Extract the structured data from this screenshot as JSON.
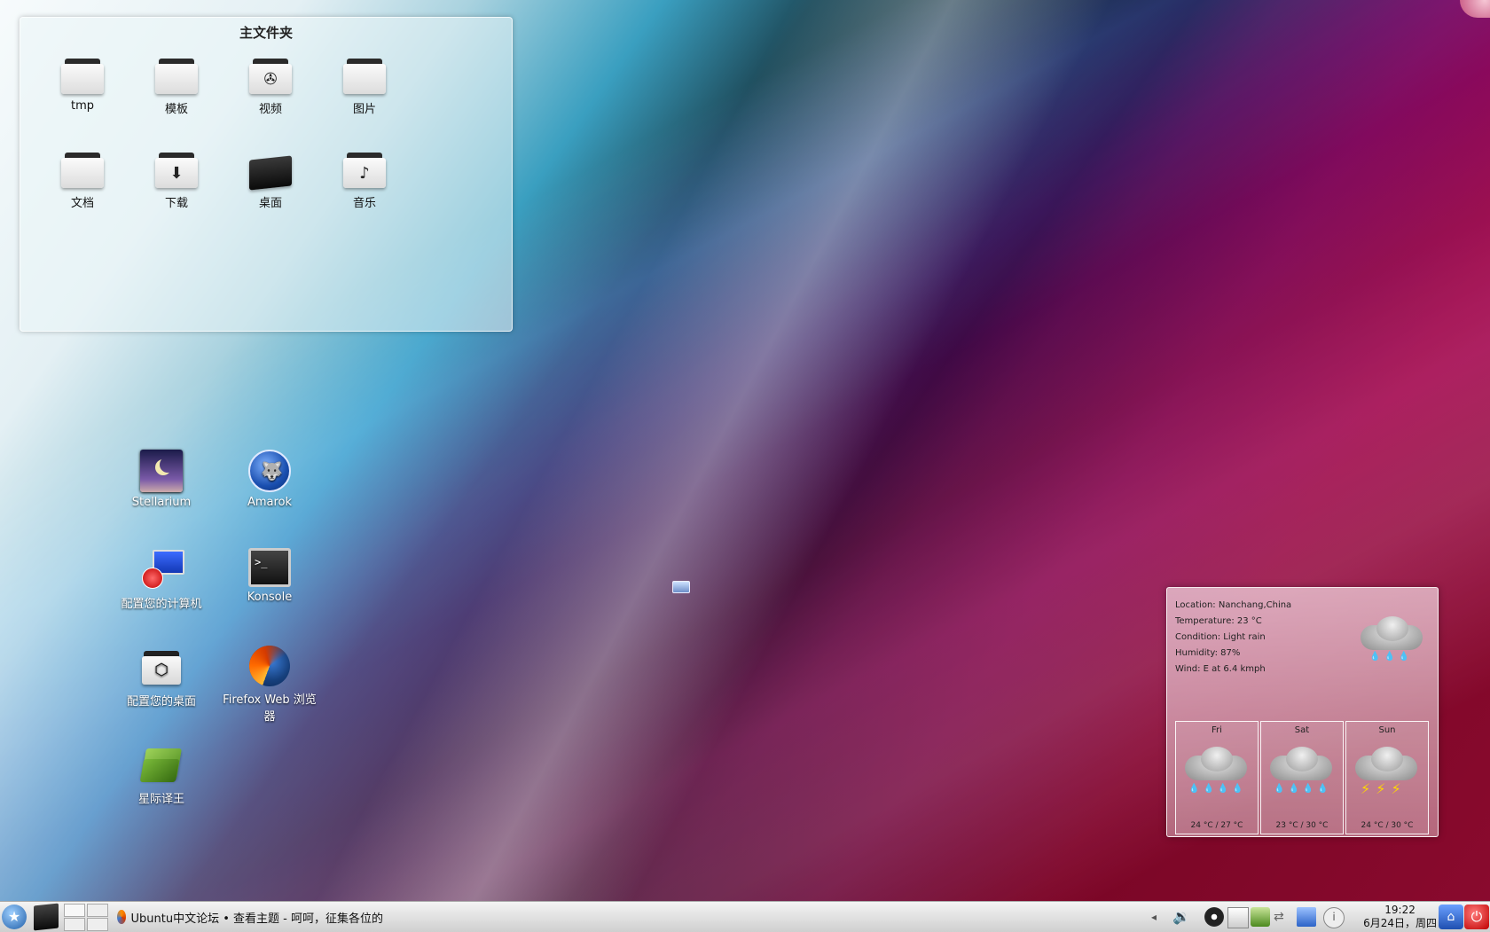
{
  "folder_view": {
    "title": "主文件夹",
    "items": [
      {
        "label": "tmp",
        "icon": "folder-icon"
      },
      {
        "label": "模板",
        "icon": "folder-icon"
      },
      {
        "label": "视频",
        "icon": "video-folder-icon"
      },
      {
        "label": "图片",
        "icon": "folder-icon"
      },
      {
        "label": "文档",
        "icon": "folder-icon"
      },
      {
        "label": "下载",
        "icon": "download-folder-icon"
      },
      {
        "label": "桌面",
        "icon": "desktop-folder-icon"
      },
      {
        "label": "音乐",
        "icon": "music-folder-icon"
      }
    ]
  },
  "desktop_icons": [
    {
      "label": "Stellarium",
      "icon": "stellarium-icon"
    },
    {
      "label": "Amarok",
      "icon": "amarok-icon"
    },
    {
      "label": "配置您的计算机",
      "icon": "computer-settings-icon"
    },
    {
      "label": "Konsole",
      "icon": "terminal-icon"
    },
    {
      "label": "配置您的桌面",
      "icon": "desktop-settings-icon"
    },
    {
      "label": "Firefox Web 浏览器",
      "icon": "firefox-icon"
    },
    {
      "label": "星际译王",
      "icon": "stardict-icon"
    }
  ],
  "weather": {
    "location": "Location: Nanchang,China",
    "temperature": "Temperature: 23 °C",
    "condition": "Condition: Light rain",
    "humidity": "Humidity: 87%",
    "wind": "Wind: E at 6.4 kmph",
    "forecast": [
      {
        "day": "Fri",
        "temps": "24 °C / 27 °C",
        "icon": "rain-icon"
      },
      {
        "day": "Sat",
        "temps": "23 °C / 30 °C",
        "icon": "rain-icon"
      },
      {
        "day": "Sun",
        "temps": "24 °C / 30 °C",
        "icon": "thunderstorm-icon"
      }
    ]
  },
  "taskbar": {
    "task_title": "Ubuntu中文论坛 • 查看主题 - 呵呵，征集各位的",
    "clock_time": "19:22",
    "clock_date": "6月24日，周四"
  }
}
